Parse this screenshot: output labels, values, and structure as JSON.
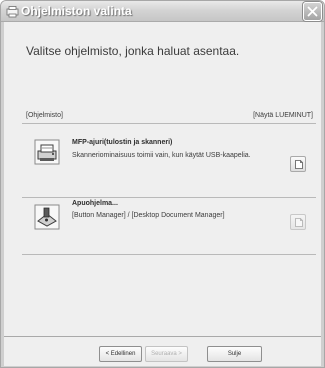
{
  "window": {
    "title": "Ohjelmiston valinta"
  },
  "instruction": "Valitse ohjelmisto, jonka haluat asentaa.",
  "list_header": {
    "left": "[Ohjelmisto]",
    "right": "[Näytä LUEMINUT]"
  },
  "items": [
    {
      "title": "MFP-ajuri(tulostin ja skanneri)",
      "description": "Skanneriominaisuus toimii vain, kun käytät USB-kaapelia.",
      "icon": "printer-scanner-icon",
      "readme_icon": "readme-document-icon"
    },
    {
      "title": "Apuohjelma...",
      "description": "[Button Manager] / [Desktop Document Manager]",
      "icon": "utility-tool-icon",
      "readme_icon": "readme-document-icon"
    }
  ],
  "buttons": {
    "back": "< Edellinen",
    "next": "Seuraava >",
    "close": "Sulje"
  }
}
